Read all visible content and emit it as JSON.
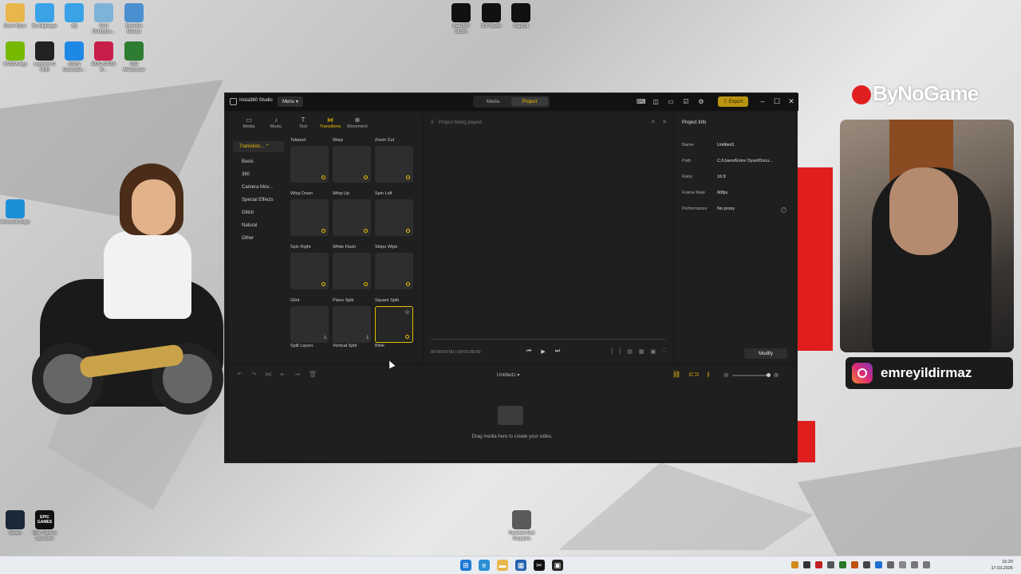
{
  "desktop": {
    "icons_top_left": [
      {
        "label": "Emre Oyun",
        "icon": "folder-user-icon",
        "color": "#e8b64a"
      },
      {
        "label": "Bu bilgisayar",
        "icon": "computer-icon",
        "color": "#3aa3e8"
      },
      {
        "label": "Ağ",
        "icon": "network-icon",
        "color": "#3aa3e8"
      },
      {
        "label": "Geri Dönüşüm...",
        "icon": "recycle-bin-icon",
        "color": "#7fb2d8"
      },
      {
        "label": "Denetim Masası",
        "icon": "control-panel-icon",
        "color": "#4a90d0"
      }
    ],
    "icons_row2": [
      {
        "label": "NVIDIA App",
        "icon": "nvidia-icon",
        "color": "#76b900"
      },
      {
        "label": "Logitech G HUB",
        "icon": "logitech-icon",
        "color": "#222222"
      },
      {
        "label": "ASUS Extended...",
        "icon": "gear-app-icon",
        "color": "#1e88e5"
      },
      {
        "label": "ROG STRIX B...",
        "icon": "rog-icon",
        "color": "#c81e4a"
      },
      {
        "label": "MSI Afterburner",
        "icon": "msi-icon",
        "color": "#2e7d32"
      }
    ],
    "icons_top_center": [
      {
        "label": "Insta360 Studio",
        "icon": "insta360-icon",
        "color": "#111111"
      },
      {
        "label": "DJI Studio",
        "icon": "dji-icon",
        "color": "#111111"
      },
      {
        "label": "CapCut",
        "icon": "capcut-icon",
        "color": "#111111"
      }
    ],
    "edge": {
      "label": "Microsoft Edge",
      "icon": "edge-icon"
    },
    "bottom_left": [
      {
        "label": "Steam",
        "icon": "steam-icon",
        "color": "#1b2838"
      },
      {
        "label": "Epic Games Launcher",
        "icon": "epic-icon",
        "color": "#111111",
        "text": "EPIC GAMES"
      }
    ],
    "bottom_center": {
      "label": "Resident Evil Requiem",
      "icon": "game-shortcut-icon"
    }
  },
  "overlay": {
    "brand": "ByNoGame",
    "instagram_handle": "emreyildirmaz"
  },
  "app": {
    "title": "Insta360 Studio",
    "menu_label": "Menu",
    "mode_tabs": [
      {
        "label": "Media",
        "active": false
      },
      {
        "label": "Project",
        "active": true
      }
    ],
    "export_label": "Export",
    "library_tabs": [
      {
        "label": "Media",
        "icon": "media-icon",
        "active": false
      },
      {
        "label": "Music",
        "icon": "music-icon",
        "active": false
      },
      {
        "label": "Text",
        "icon": "text-icon",
        "active": false
      },
      {
        "label": "Transitions",
        "icon": "transitions-icon",
        "active": true
      },
      {
        "label": "Movement",
        "icon": "movement-icon",
        "active": false
      }
    ],
    "category_header": "Transition...",
    "categories": [
      "Basis",
      "360",
      "Camera Mov...",
      "Special Effects",
      "Glitch",
      "Natural",
      "Other"
    ],
    "transitions": [
      {
        "label": "Teleport",
        "badge": "dot"
      },
      {
        "label": "Warp",
        "badge": "dot"
      },
      {
        "label": "Zoom Cut",
        "badge": "dot"
      },
      {
        "label": "Whip Down",
        "badge": "dot"
      },
      {
        "label": "Whip Up",
        "badge": "dot"
      },
      {
        "label": "Spin Left",
        "badge": "dot"
      },
      {
        "label": "Spin Right",
        "badge": "dot"
      },
      {
        "label": "White Flash",
        "badge": "dot"
      },
      {
        "label": "Stripe Wipe",
        "badge": "dot"
      },
      {
        "label": "Glint",
        "badge": "download"
      },
      {
        "label": "Piano Split",
        "badge": "download"
      },
      {
        "label": "Square Split",
        "badge": "dot",
        "selected": true
      }
    ],
    "transition_captions_bottom": [
      "Split Layers",
      "Vertical Split",
      "Blink"
    ],
    "preview": {
      "status": "Project being played",
      "timecode": "00:00:00:00 | 00:00:00:00"
    },
    "project_info": {
      "title": "Project Info",
      "rows": [
        {
          "key": "Name",
          "value": "Untitled1"
        },
        {
          "key": "Path",
          "value": "C:/Users/Emre Oyun/Docu..."
        },
        {
          "key": "Ratio",
          "value": "16:9"
        },
        {
          "key": "Frame Rate",
          "value": "60fps"
        },
        {
          "key": "Performance",
          "value": "No proxy"
        }
      ],
      "modify_label": "Modify"
    },
    "timeline": {
      "project_name": "Untitled1",
      "empty_text": "Drag media here to create your video."
    }
  },
  "taskbar": {
    "clock_time": "16:20",
    "clock_date": "17.03.2026"
  }
}
